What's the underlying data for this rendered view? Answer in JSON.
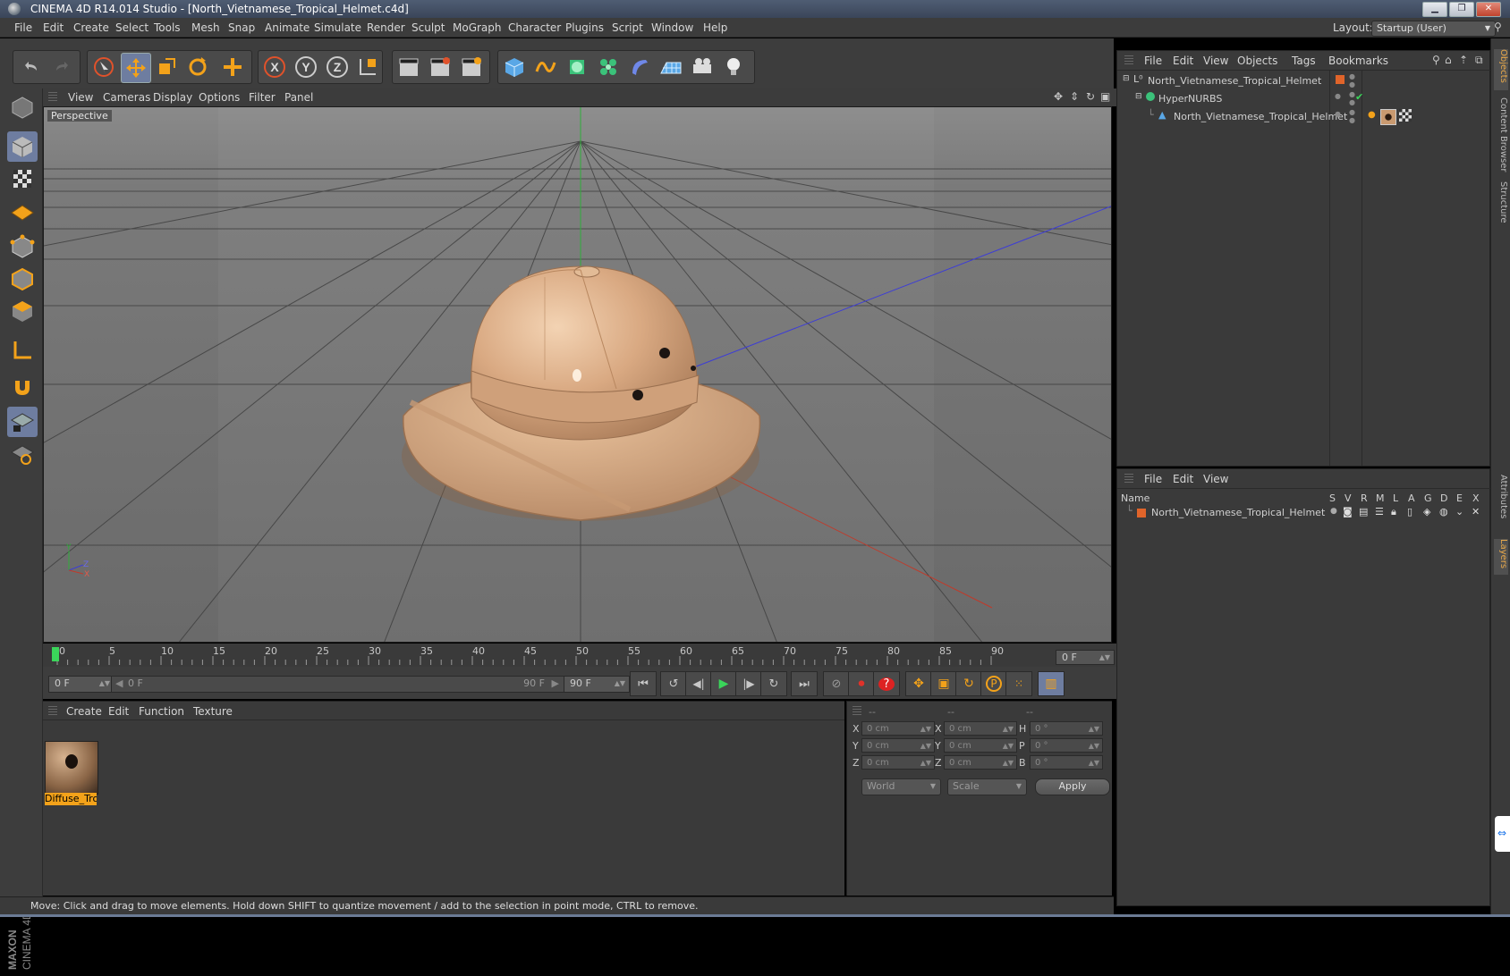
{
  "window": {
    "title": "CINEMA 4D R14.014 Studio - [North_Vietnamese_Tropical_Helmet.c4d]"
  },
  "menubar": {
    "items": [
      "File",
      "Edit",
      "Create",
      "Select",
      "Tools",
      "Mesh",
      "Snap",
      "Animate",
      "Simulate",
      "Render",
      "Sculpt",
      "MoGraph",
      "Character",
      "Plugins",
      "Script",
      "Window",
      "Help"
    ],
    "layout_label": "Layout:",
    "layout_value": "Startup (User)"
  },
  "viewport": {
    "menu": [
      "View",
      "Cameras",
      "Display",
      "Options",
      "Filter",
      "Panel"
    ],
    "camera_label": "Perspective",
    "axis_y": "Y",
    "axis_z": "Z",
    "axis_x": "X"
  },
  "timeline": {
    "ticks": [
      "0",
      "5",
      "10",
      "15",
      "20",
      "25",
      "30",
      "35",
      "40",
      "45",
      "50",
      "55",
      "60",
      "65",
      "70",
      "75",
      "80",
      "85",
      "90"
    ],
    "current_frame": "0 F",
    "start_frame": "0 F",
    "slider_start": "0 F",
    "slider_end": "90 F",
    "end_frame": "90 F"
  },
  "material_manager": {
    "menu": [
      "Create",
      "Edit",
      "Function",
      "Texture"
    ],
    "material_name": "Diffuse_Tro"
  },
  "coordinates": {
    "headers": [
      "--",
      "--",
      "--"
    ],
    "rows": [
      {
        "l1": "X",
        "v1": "0 cm",
        "l2": "X",
        "v2": "0 cm",
        "l3": "H",
        "v3": "0 °"
      },
      {
        "l1": "Y",
        "v1": "0 cm",
        "l2": "Y",
        "v2": "0 cm",
        "l3": "P",
        "v3": "0 °"
      },
      {
        "l1": "Z",
        "v1": "0 cm",
        "l2": "Z",
        "v2": "0 cm",
        "l3": "B",
        "v3": "0 °"
      }
    ],
    "mode": "World",
    "transform": "Scale",
    "apply": "Apply"
  },
  "status": {
    "text": "Move: Click and drag to move elements. Hold down SHIFT to quantize movement / add to the selection in point mode, CTRL to remove."
  },
  "object_manager": {
    "menu": [
      "File",
      "Edit",
      "View",
      "Objects",
      "Tags",
      "Bookmarks"
    ],
    "objects": [
      {
        "name": "North_Vietnamese_Tropical_Helmet"
      },
      {
        "name": "HyperNURBS"
      },
      {
        "name": "North_Vietnamese_Tropical_Helmet"
      }
    ]
  },
  "layer_manager": {
    "menu": [
      "File",
      "Edit",
      "View"
    ],
    "columns": [
      "Name",
      "S",
      "V",
      "R",
      "M",
      "L",
      "A",
      "G",
      "D",
      "E",
      "X"
    ],
    "layers": [
      {
        "name": "North_Vietnamese_Tropical_Helmet"
      }
    ]
  },
  "right_tabs": [
    "Objects",
    "Content Browser",
    "Structure",
    "Attributes",
    "Layers"
  ],
  "colors": {
    "accent_orange": "#f3a21a",
    "selection_blue": "#6e7da0",
    "layer_color": "#e0642a"
  }
}
